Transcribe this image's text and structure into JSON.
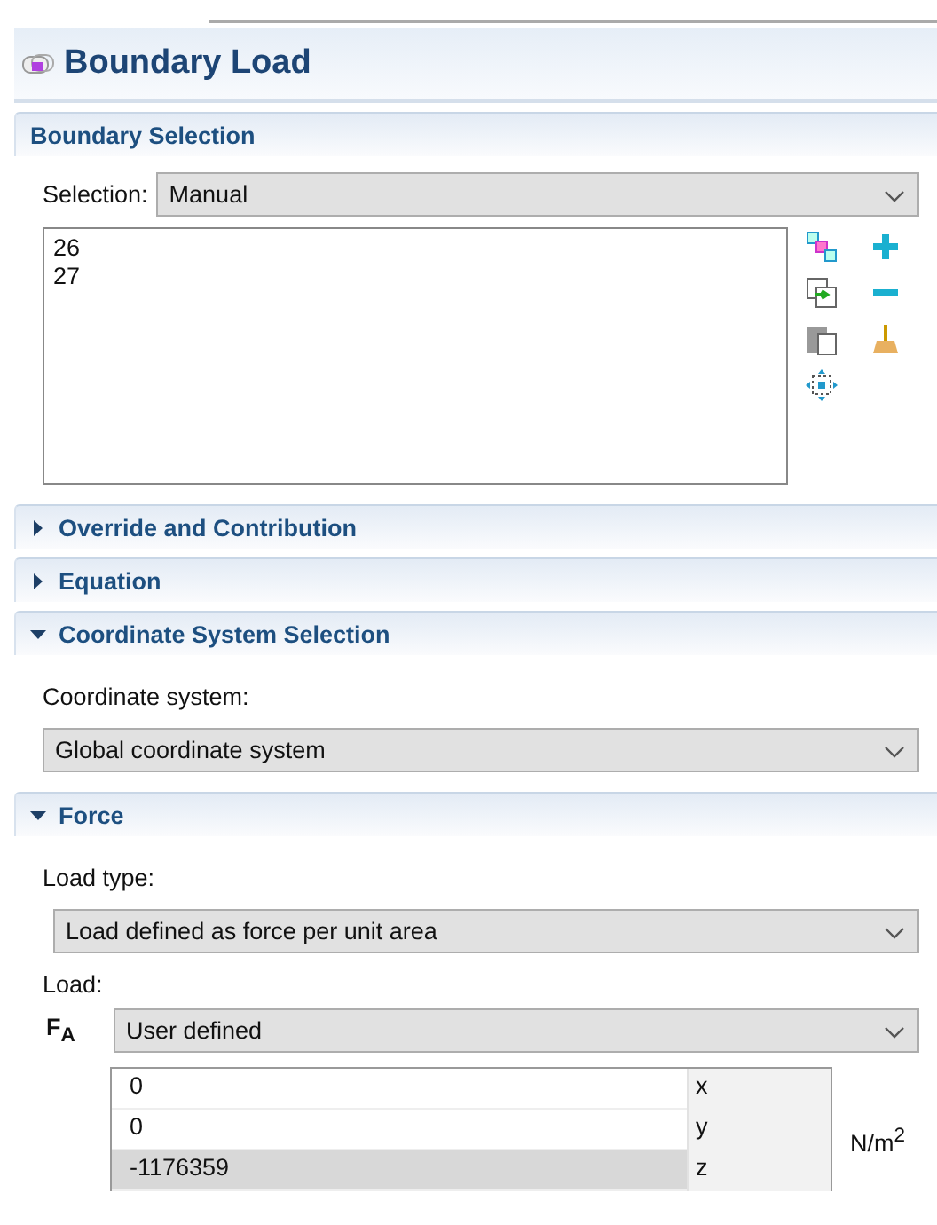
{
  "title": "Boundary Load",
  "sections": [
    {
      "kind": "boundary_selection",
      "title": "Boundary Selection",
      "selection_label": "Selection:",
      "selection_value": "Manual",
      "items": [
        "26",
        "27"
      ]
    },
    {
      "title": "Override and Contribution",
      "expanded": false
    },
    {
      "title": "Equation",
      "expanded": false
    },
    {
      "kind": "coordinate",
      "title": "Coordinate System Selection",
      "expanded": true,
      "label": "Coordinate system:",
      "value": "Global coordinate system"
    },
    {
      "kind": "force",
      "title": "Force",
      "expanded": true,
      "load_type_label": "Load type:",
      "load_type_value": "Load defined as force per unit area",
      "load_label": "Load:",
      "symbol": "F$_{A}$",
      "load_value": "User defined",
      "unit": "N/m$^{2}$",
      "rows": [
        {
          "value": "0",
          "axis": "x",
          "selected": false
        },
        {
          "value": "0",
          "axis": "y",
          "selected": false
        },
        {
          "value": "-1176359",
          "axis": "z",
          "selected": true
        }
      ]
    }
  ]
}
